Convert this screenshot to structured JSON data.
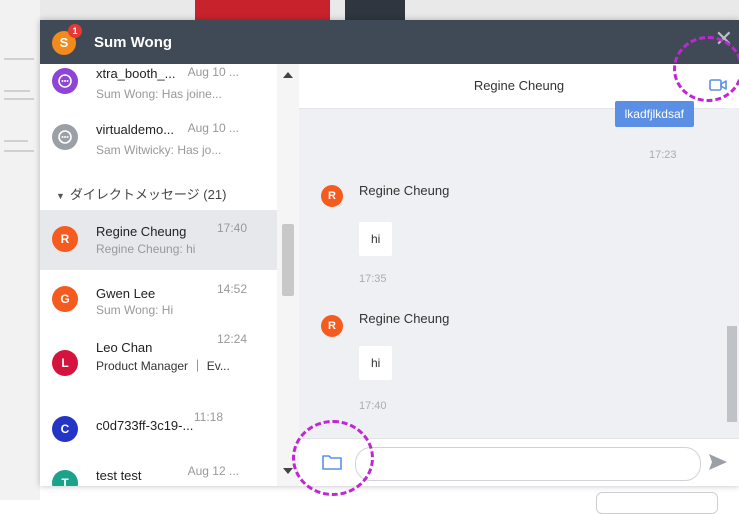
{
  "window": {
    "title": "Sum Wong",
    "avatar_letter": "S",
    "badge": "1"
  },
  "sidebar": {
    "items_top": [
      {
        "name": "xtra_booth_...",
        "time": "Aug 10 ...",
        "sub": "Sum Wong: Has joine...",
        "avatar_icon": "chat-group-icon",
        "avatar_color": "#8e44d6"
      },
      {
        "name": "virtualdemo...",
        "time": "Aug 10 ...",
        "sub": "Sam Witwicky: Has jo...",
        "avatar_icon": "chat-group-icon",
        "avatar_color": "#9aa0a6"
      }
    ],
    "section_label": "ダイレクトメッセージ (21)",
    "dm": [
      {
        "letter": "R",
        "name": "Regine Cheung",
        "time": "17:40",
        "sub": "Regine Cheung: hi",
        "color": "#f55a1f"
      },
      {
        "letter": "G",
        "name": "Gwen Lee",
        "time": "14:52",
        "sub": "Sum Wong: Hi",
        "color": "#f55a1f"
      },
      {
        "letter": "L",
        "name": "Leo Chan",
        "time": "12:24",
        "sub": "Product Manager ｜ Ev...",
        "color": "#d4143c"
      },
      {
        "letter": "C",
        "name": "c0d733ff-3c19-...",
        "time": "11:18",
        "sub": "",
        "color": "#2434c4"
      },
      {
        "letter": "T",
        "name": "test test",
        "time": "Aug 12 ...",
        "sub": "",
        "color": "#1aa38a"
      }
    ]
  },
  "chat": {
    "title": "Regine Cheung",
    "outgoing": {
      "text": "lkadfjlkdsaf",
      "time": "17:23"
    },
    "incoming": [
      {
        "letter": "R",
        "sender": "Regine Cheung",
        "text": "hi",
        "time": "17:35"
      },
      {
        "letter": "R",
        "sender": "Regine Cheung",
        "text": "hi",
        "time": "17:40"
      }
    ],
    "input_placeholder": ""
  },
  "colors": {
    "titlebar": "#3f4a56",
    "accent": "#5b8fe5",
    "highlight": "#c026d3"
  }
}
